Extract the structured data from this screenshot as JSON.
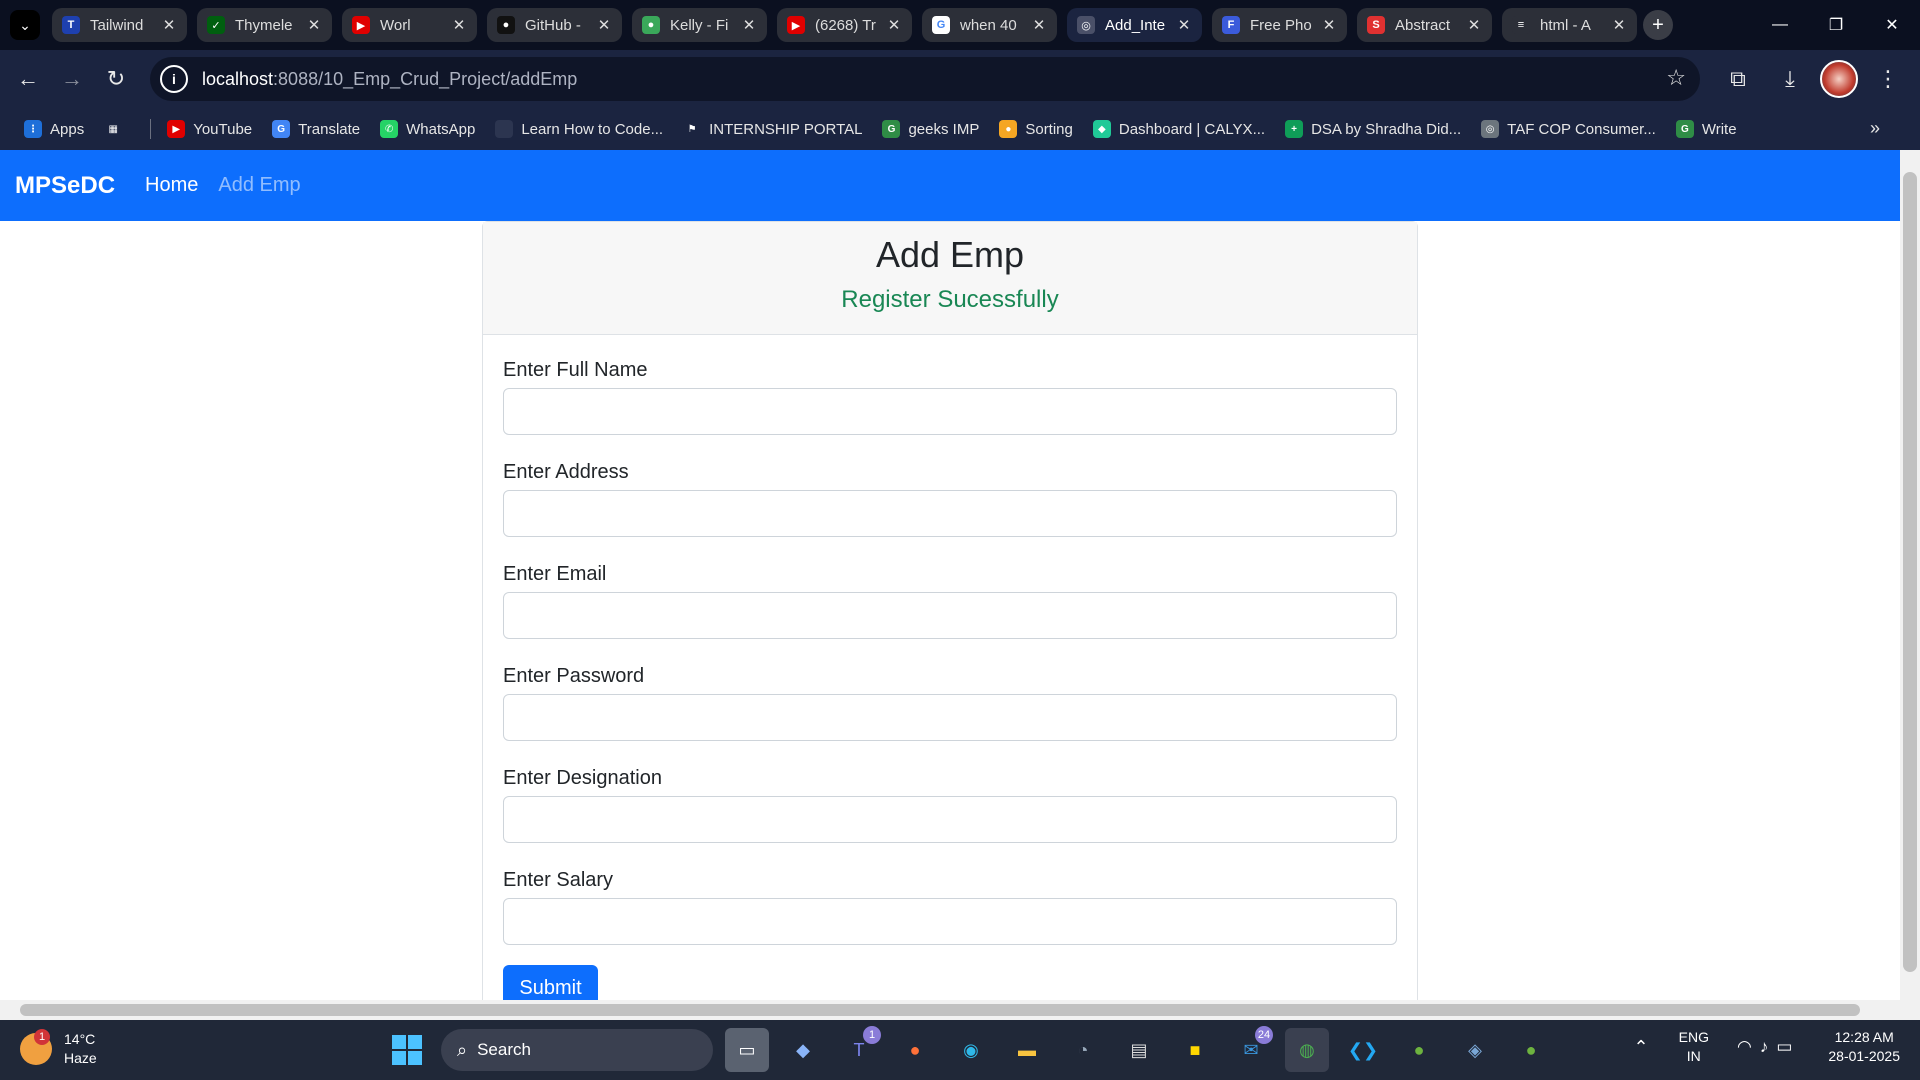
{
  "browser": {
    "tabs": [
      {
        "title": "Tailwind",
        "icon": "tailwind-icon",
        "color": "#1e40af",
        "glyph": "T"
      },
      {
        "title": "Thymele",
        "icon": "thymeleaf-icon",
        "color": "#005f0f",
        "glyph": "✓"
      },
      {
        "title": "Worl",
        "icon": "youtube-icon",
        "color": "#e00000",
        "glyph": "▶"
      },
      {
        "title": "GitHub -",
        "icon": "github-icon",
        "color": "#111111",
        "glyph": "●"
      },
      {
        "title": "Kelly - Fi",
        "icon": "leaf-icon",
        "color": "#3aa85a",
        "glyph": "●"
      },
      {
        "title": "(6268) Tr",
        "icon": "youtube-icon",
        "color": "#e00000",
        "glyph": "▶"
      },
      {
        "title": "when 40",
        "icon": "google-icon",
        "color": "#ffffff",
        "glyph": "G"
      },
      {
        "title": "Add_Inte",
        "icon": "globe-icon",
        "color": "#4a5068",
        "glyph": "◎",
        "active": true
      },
      {
        "title": "Free Pho",
        "icon": "free-photo-icon",
        "color": "#3b5bdb",
        "glyph": "F"
      },
      {
        "title": "Abstract",
        "icon": "abstract-icon",
        "color": "#e03131",
        "glyph": "S"
      },
      {
        "title": "html - A",
        "icon": "stackoverflow-icon",
        "color": "#2c2f38",
        "glyph": "≡"
      }
    ],
    "url_host": "localhost",
    "url_path": ":8088/10_Emp_Crud_Project/addEmp",
    "bookmarks": [
      {
        "label": "Apps",
        "icon": "apps-grid-icon",
        "color": "#1e6fd9",
        "glyph": "⋮"
      },
      {
        "label": "",
        "icon": "tab-groups-icon",
        "color": "#1b2440",
        "glyph": "▦"
      },
      {
        "label": "YouTube",
        "icon": "youtube-icon",
        "color": "#e00000",
        "glyph": "▶"
      },
      {
        "label": "Translate",
        "icon": "translate-icon",
        "color": "#4285f4",
        "glyph": "G"
      },
      {
        "label": "WhatsApp",
        "icon": "whatsapp-icon",
        "color": "#25d366",
        "glyph": "✆"
      },
      {
        "label": "Learn How to Code...",
        "icon": "page-icon",
        "color": "#2c3550",
        "glyph": " "
      },
      {
        "label": "INTERNSHIP PORTAL",
        "icon": "internship-icon",
        "color": "#1b2440",
        "glyph": "⚑"
      },
      {
        "label": "geeks IMP",
        "icon": "geeksforgeeks-icon",
        "color": "#2f8d46",
        "glyph": "G"
      },
      {
        "label": "Sorting",
        "icon": "sorting-icon",
        "color": "#f5a623",
        "glyph": "●"
      },
      {
        "label": "Dashboard | CALYX...",
        "icon": "calyx-icon",
        "color": "#20c997",
        "glyph": "◆"
      },
      {
        "label": "DSA by Shradha Did...",
        "icon": "sheets-icon",
        "color": "#0f9d58",
        "glyph": "+"
      },
      {
        "label": "TAF COP Consumer...",
        "icon": "tafcop-icon",
        "color": "#6c757d",
        "glyph": "◎"
      },
      {
        "label": "Write",
        "icon": "geeksforgeeks-icon",
        "color": "#2f8d46",
        "glyph": "G"
      }
    ]
  },
  "navbar": {
    "brand": "MPSeDC",
    "links": [
      "Home",
      "Add Emp"
    ]
  },
  "form": {
    "title": "Add Emp",
    "message": "Register Sucessfully",
    "fields": [
      {
        "label": "Enter Full Name",
        "value": ""
      },
      {
        "label": "Enter Address",
        "value": ""
      },
      {
        "label": "Enter Email",
        "value": ""
      },
      {
        "label": "Enter Password",
        "value": ""
      },
      {
        "label": "Enter Designation",
        "value": ""
      },
      {
        "label": "Enter Salary",
        "value": ""
      }
    ],
    "submit_label": "Submit"
  },
  "colors": {
    "primary": "#0d6efd",
    "success": "#198754"
  },
  "taskbar": {
    "weather_badge": "1",
    "temperature": "14°C",
    "condition": "Haze",
    "search_label": "Search",
    "teams_badge": "1",
    "mail_badge": "24",
    "lang_top": "ENG",
    "lang_bottom": "IN",
    "time": "12:28 AM",
    "date": "28-01-2025"
  }
}
